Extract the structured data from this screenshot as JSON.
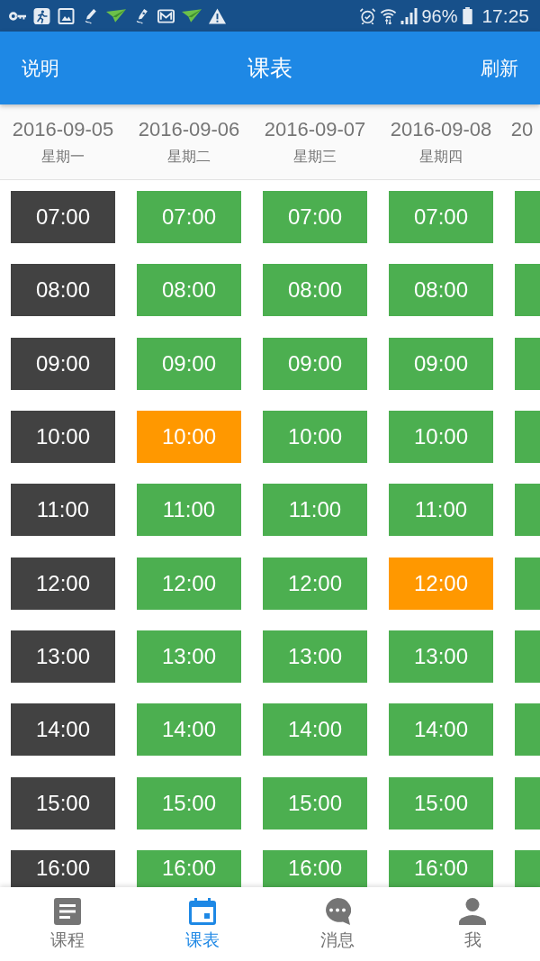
{
  "status_bar": {
    "battery": "96%",
    "time": "17:25"
  },
  "header": {
    "left_button": "说明",
    "title": "课表",
    "right_button": "刷新"
  },
  "days": [
    {
      "date": "2016-09-05",
      "weekday": "星期一",
      "slots": [
        {
          "time": "07:00",
          "kind": "past"
        },
        {
          "time": "08:00",
          "kind": "past"
        },
        {
          "time": "09:00",
          "kind": "past"
        },
        {
          "time": "10:00",
          "kind": "past"
        },
        {
          "time": "11:00",
          "kind": "past"
        },
        {
          "time": "12:00",
          "kind": "past"
        },
        {
          "time": "13:00",
          "kind": "past"
        },
        {
          "time": "14:00",
          "kind": "past"
        },
        {
          "time": "15:00",
          "kind": "past"
        },
        {
          "time": "16:00",
          "kind": "past"
        }
      ]
    },
    {
      "date": "2016-09-06",
      "weekday": "星期二",
      "slots": [
        {
          "time": "07:00",
          "kind": "available"
        },
        {
          "time": "08:00",
          "kind": "available"
        },
        {
          "time": "09:00",
          "kind": "available"
        },
        {
          "time": "10:00",
          "kind": "booked"
        },
        {
          "time": "11:00",
          "kind": "available"
        },
        {
          "time": "12:00",
          "kind": "available"
        },
        {
          "time": "13:00",
          "kind": "available"
        },
        {
          "time": "14:00",
          "kind": "available"
        },
        {
          "time": "15:00",
          "kind": "available"
        },
        {
          "time": "16:00",
          "kind": "available"
        }
      ]
    },
    {
      "date": "2016-09-07",
      "weekday": "星期三",
      "slots": [
        {
          "time": "07:00",
          "kind": "available"
        },
        {
          "time": "08:00",
          "kind": "available"
        },
        {
          "time": "09:00",
          "kind": "available"
        },
        {
          "time": "10:00",
          "kind": "available"
        },
        {
          "time": "11:00",
          "kind": "available"
        },
        {
          "time": "12:00",
          "kind": "available"
        },
        {
          "time": "13:00",
          "kind": "available"
        },
        {
          "time": "14:00",
          "kind": "available"
        },
        {
          "time": "15:00",
          "kind": "available"
        },
        {
          "time": "16:00",
          "kind": "available"
        }
      ]
    },
    {
      "date": "2016-09-08",
      "weekday": "星期四",
      "slots": [
        {
          "time": "07:00",
          "kind": "available"
        },
        {
          "time": "08:00",
          "kind": "available"
        },
        {
          "time": "09:00",
          "kind": "available"
        },
        {
          "time": "10:00",
          "kind": "available"
        },
        {
          "time": "11:00",
          "kind": "available"
        },
        {
          "time": "12:00",
          "kind": "booked"
        },
        {
          "time": "13:00",
          "kind": "available"
        },
        {
          "time": "14:00",
          "kind": "available"
        },
        {
          "time": "15:00",
          "kind": "available"
        },
        {
          "time": "16:00",
          "kind": "available"
        }
      ]
    },
    {
      "date": "20",
      "slots": [
        {
          "kind": "available"
        },
        {
          "kind": "available"
        },
        {
          "kind": "available"
        },
        {
          "kind": "available"
        },
        {
          "kind": "available"
        },
        {
          "kind": "available"
        },
        {
          "kind": "available"
        },
        {
          "kind": "available"
        },
        {
          "kind": "available"
        },
        {
          "kind": "available"
        }
      ]
    }
  ],
  "bottom_nav": [
    {
      "label": "课程",
      "selected": false
    },
    {
      "label": "课表",
      "selected": true
    },
    {
      "label": "消息",
      "selected": false
    },
    {
      "label": "我",
      "selected": false
    }
  ]
}
